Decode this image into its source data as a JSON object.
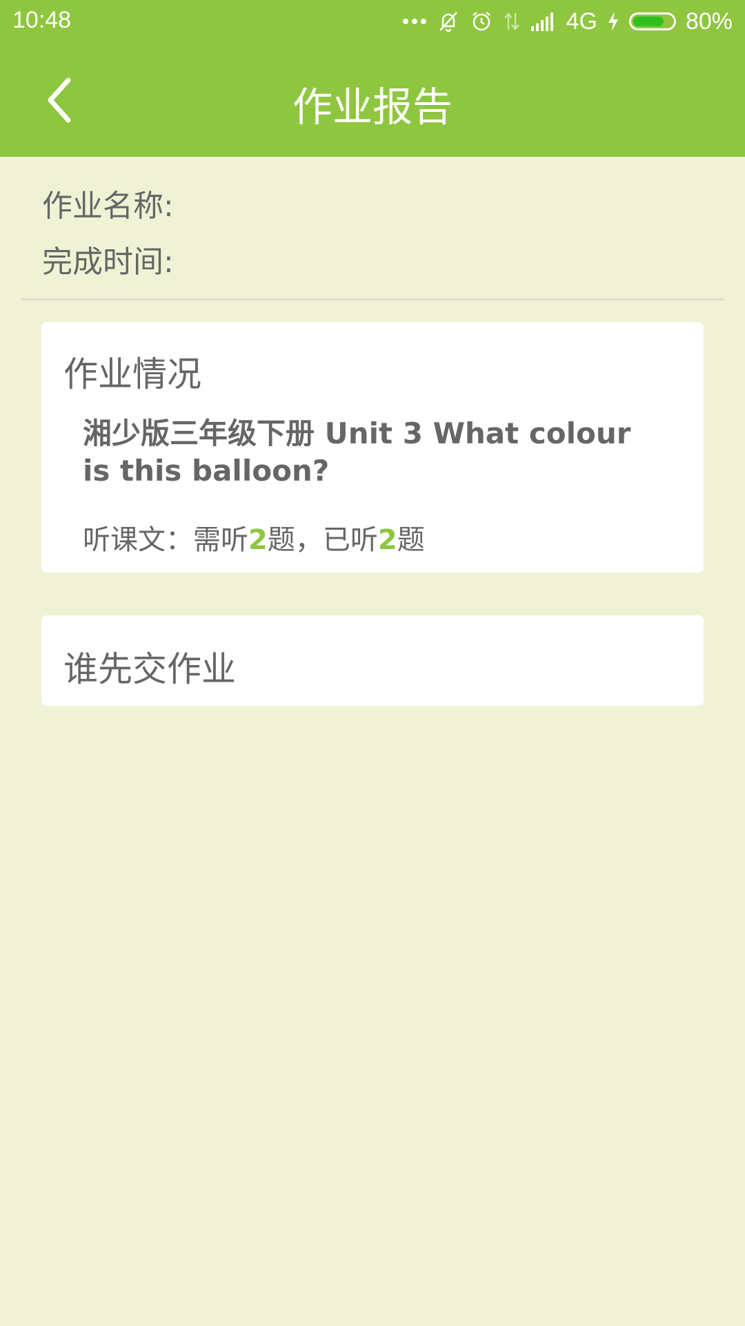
{
  "status_bar": {
    "time": "10:48",
    "network": "4G",
    "battery": "80%",
    "battery_level": 0.8,
    "icons": [
      "more-icon",
      "bell-muted-icon",
      "alarm-icon",
      "data-arrows-icon",
      "signal-icon",
      "charging-icon",
      "battery-icon"
    ]
  },
  "header": {
    "back_icon": "chevron-left-icon",
    "title": "作业报告"
  },
  "info": {
    "name_label": "作业名称:",
    "time_label": "完成时间:"
  },
  "homework_card": {
    "title": "作业情况",
    "book": "湘少版三年级下册 Unit 3 What colour is this balloon?",
    "listen_prefix": "听课文：需听",
    "required": "2",
    "listen_middle": "题，已听",
    "done": "2",
    "listen_suffix": "题"
  },
  "submit_card": {
    "title": "谁先交作业"
  },
  "colors": {
    "brand_green": "#8ec63f",
    "background": "#f0f2d5",
    "text": "#666666"
  }
}
